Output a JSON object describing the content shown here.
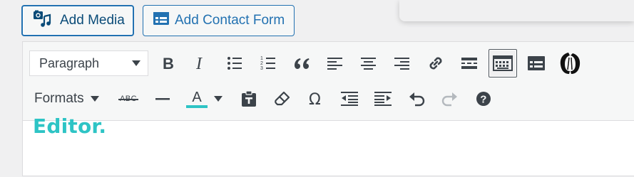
{
  "media_buttons": {
    "add_media_label": "Add Media",
    "add_form_label": "Add Contact Form"
  },
  "toolbar": {
    "row1": {
      "format_select_value": "Paragraph",
      "buttons": [
        "bold",
        "italic",
        "bulleted-list",
        "numbered-list",
        "blockquote",
        "align-left",
        "align-center",
        "align-right",
        "insert-link",
        "read-more",
        "toolbar-toggle",
        "form-icon",
        "custom-logo"
      ]
    },
    "row2": {
      "formats_label": "Formats",
      "strikethrough_text": "ABC",
      "text_color_letter": "A",
      "text_color_swatch": "#2ec4c5",
      "buttons": [
        "formats",
        "strikethrough",
        "horizontal-line",
        "text-color",
        "paste-as-text",
        "clear-formatting",
        "special-character",
        "decrease-indent",
        "increase-indent",
        "undo",
        "redo",
        "keyboard-shortcuts-help"
      ]
    }
  },
  "content": {
    "visible_heading_fragment": "Editor.",
    "heading_color": "#2ec4c5"
  },
  "colors": {
    "accent": "#2271b1",
    "toolbar_bg": "#f6f7f7",
    "icon": "#3c434a"
  }
}
